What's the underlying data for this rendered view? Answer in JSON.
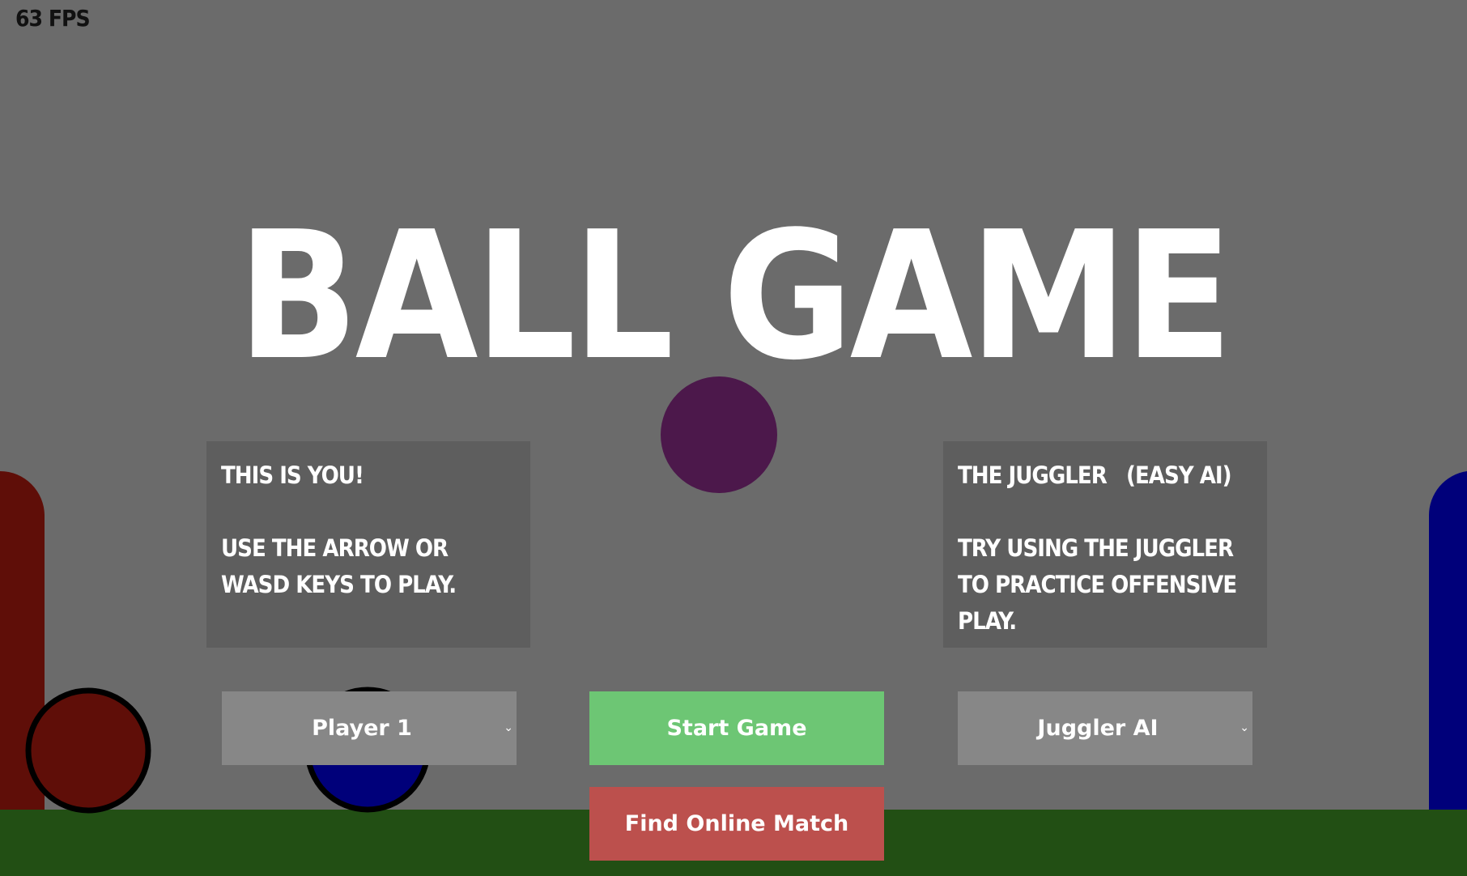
{
  "hud": {
    "fps_text": "63 FPS"
  },
  "title": "BALL GAME",
  "left_panel": {
    "heading": "THIS IS YOU!",
    "body": "USE THE ARROW OR WASD KEYS TO PLAY."
  },
  "right_panel": {
    "heading": "THE JUGGLER   (EASY AI)",
    "body": "TRY USING THE JUGGLER TO PRACTICE OFFENSIVE PLAY."
  },
  "controls": {
    "left_select_value": "Player 1",
    "right_select_value": "Juggler AI",
    "start_label": "Start Game",
    "online_label": "Find Online Match"
  },
  "colors": {
    "background": "#6b6b6b",
    "ground": "#224f14",
    "red_team": "#5f0e08",
    "blue_team": "#00007a",
    "ball": "#4c184b",
    "panel": "#5e5e5e",
    "select": "#878787",
    "start_button": "#6dc674",
    "online_button": "#bc504d"
  },
  "icons": {
    "dropdown": "chevron-down-icon"
  }
}
